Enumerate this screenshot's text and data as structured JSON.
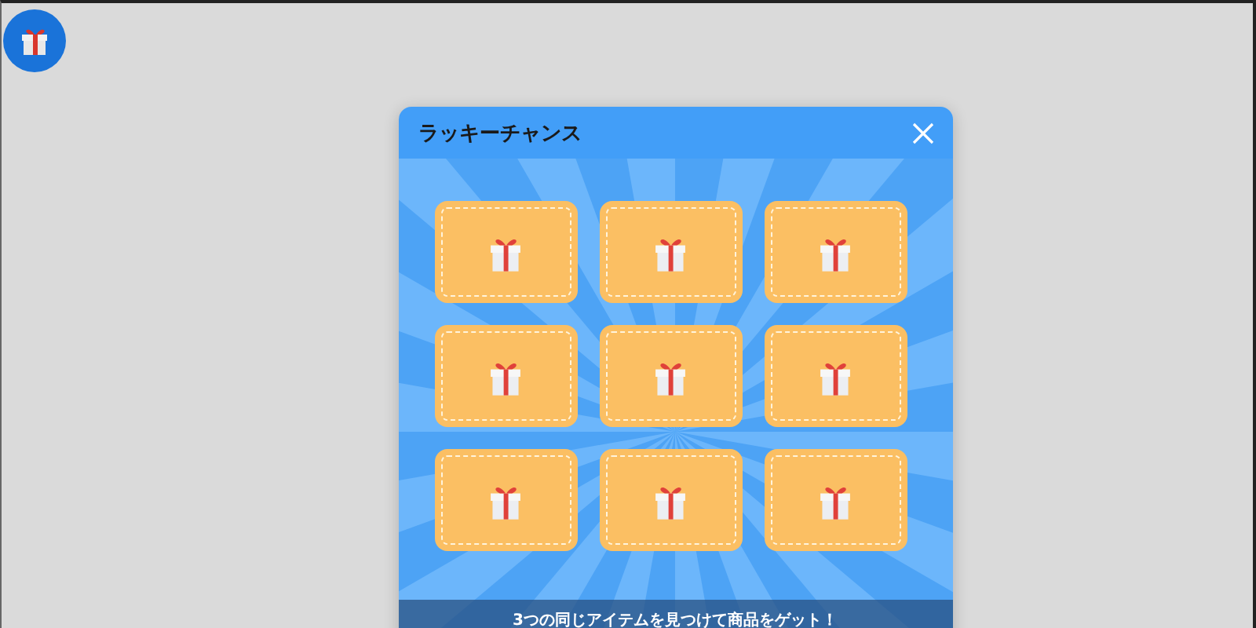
{
  "floating_button": {
    "kind": "gift"
  },
  "dialog": {
    "title": "ラッキーチャンス",
    "cards": [
      {
        "kind": "gift"
      },
      {
        "kind": "gift"
      },
      {
        "kind": "gift"
      },
      {
        "kind": "gift"
      },
      {
        "kind": "gift"
      },
      {
        "kind": "gift"
      },
      {
        "kind": "gift"
      },
      {
        "kind": "gift"
      },
      {
        "kind": "gift"
      }
    ],
    "footer": "3つの同じアイテムを見つけて商品をゲット！"
  }
}
